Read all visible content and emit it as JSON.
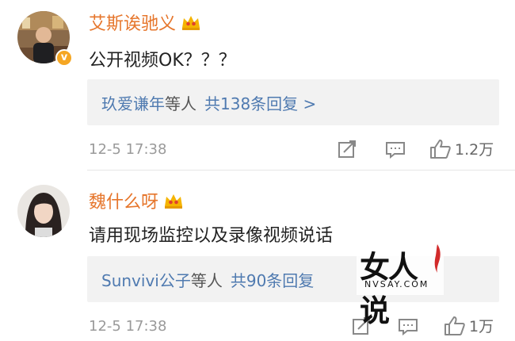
{
  "comments": [
    {
      "username": "艾斯诶驰义",
      "text": "公开视频OK？？？",
      "verified_badge": "v",
      "reply": {
        "names": "玖爱谦年",
        "etc": "等人",
        "count": "共138条回复 >"
      },
      "time": "12-5 17:38",
      "likes": "1.2万",
      "icons": [
        "share-icon",
        "comment-icon",
        "like-icon"
      ]
    },
    {
      "username": "魏什么呀",
      "text": "请用现场监控以及录像视频说话",
      "reply": {
        "names": "Sunvivi公子",
        "etc": "等人",
        "count": "共90条回复"
      },
      "time": "12-5 17:38",
      "likes": "1万",
      "icons": [
        "share-icon",
        "comment-icon",
        "like-icon"
      ]
    }
  ],
  "watermark": {
    "title": "女人说",
    "subtitle": "NVSAY.COM"
  },
  "colors": {
    "username": "#e6762c",
    "link": "#4f7ab0",
    "meta": "#9a9a9a",
    "reply_bg": "#f2f2f2",
    "badge": "#f5a623"
  }
}
